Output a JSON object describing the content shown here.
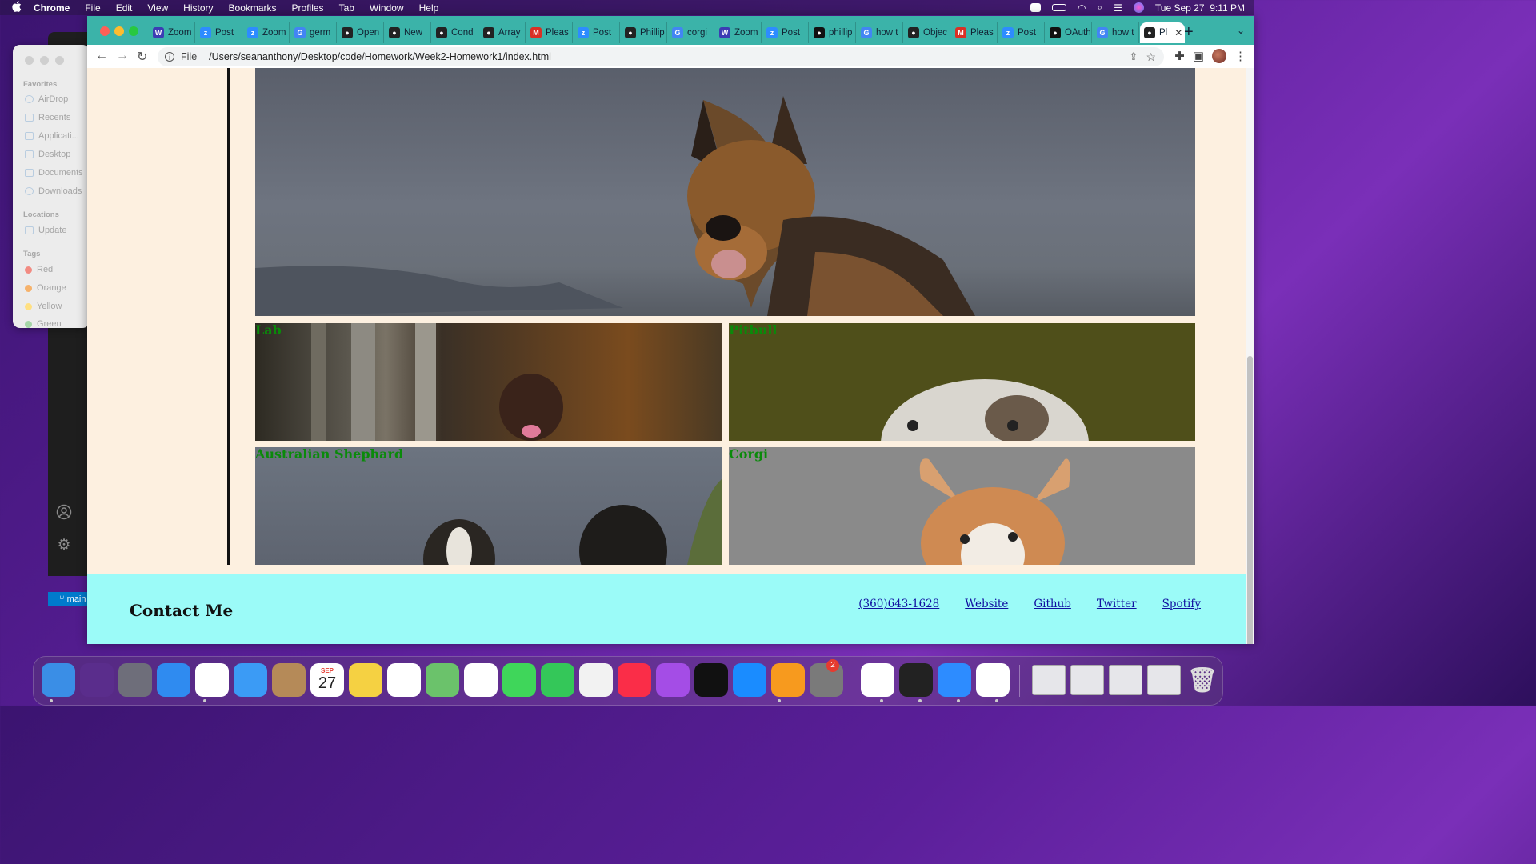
{
  "menubar": {
    "app": "Chrome",
    "items": [
      "File",
      "Edit",
      "View",
      "History",
      "Bookmarks",
      "Profiles",
      "Tab",
      "Window",
      "Help"
    ],
    "clock": "Tue Sep 27  9:11 PM"
  },
  "finder": {
    "favorites_label": "Favorites",
    "favorites": [
      "AirDrop",
      "Recents",
      "Applicati...",
      "Desktop",
      "Documents",
      "Downloads"
    ],
    "locations_label": "Locations",
    "locations": [
      "Update"
    ],
    "tags_label": "Tags",
    "tags": [
      {
        "name": "Red",
        "color": "#f28b82"
      },
      {
        "name": "Orange",
        "color": "#f6b26b"
      },
      {
        "name": "Yellow",
        "color": "#ffe082"
      },
      {
        "name": "Green",
        "color": "#a5d6a7"
      }
    ]
  },
  "vscode": {
    "branch": "main"
  },
  "chrome": {
    "tabs": [
      {
        "title": "Zoom",
        "icon": "W",
        "color": "#3c3cb4"
      },
      {
        "title": "Post",
        "icon": "z",
        "color": "#2d8cff"
      },
      {
        "title": "Zoom",
        "icon": "z",
        "color": "#2d8cff"
      },
      {
        "title": "germ",
        "icon": "G",
        "color": "#4285f4"
      },
      {
        "title": "Open",
        "icon": "●",
        "color": "#222222"
      },
      {
        "title": "New",
        "icon": "●",
        "color": "#222222"
      },
      {
        "title": "Cond",
        "icon": "●",
        "color": "#222222"
      },
      {
        "title": "Array",
        "icon": "●",
        "color": "#222222"
      },
      {
        "title": "Pleas",
        "icon": "M",
        "color": "#d93025"
      },
      {
        "title": "Post",
        "icon": "z",
        "color": "#2d8cff"
      },
      {
        "title": "Phillip",
        "icon": "●",
        "color": "#222222"
      },
      {
        "title": "corgi",
        "icon": "G",
        "color": "#4285f4"
      },
      {
        "title": "Zoom",
        "icon": "W",
        "color": "#3c3cb4"
      },
      {
        "title": "Post",
        "icon": "z",
        "color": "#2d8cff"
      },
      {
        "title": "phillip",
        "icon": "●",
        "color": "#111111"
      },
      {
        "title": "how t",
        "icon": "G",
        "color": "#4285f4"
      },
      {
        "title": "Objec",
        "icon": "●",
        "color": "#222222"
      },
      {
        "title": "Pleas",
        "icon": "M",
        "color": "#d93025"
      },
      {
        "title": "Post",
        "icon": "z",
        "color": "#2d8cff"
      },
      {
        "title": "OAuth",
        "icon": "●",
        "color": "#111111"
      },
      {
        "title": "how t",
        "icon": "G",
        "color": "#4285f4"
      },
      {
        "title": "Pl",
        "icon": "●",
        "color": "#222222",
        "active": true
      }
    ],
    "address": {
      "scheme": "File",
      "url": "/Users/seananthony/Desktop/code/Homework/Week2-Homework1/index.html"
    }
  },
  "page": {
    "tiles": [
      {
        "label": "Lab"
      },
      {
        "label": "Pitbull"
      },
      {
        "label": "Australian Shephard"
      },
      {
        "label": "Corgi"
      }
    ],
    "footer": {
      "title": "Contact Me",
      "links": [
        "(360)643-1628",
        "Website",
        "Github",
        "Twitter",
        "Spotify"
      ]
    }
  },
  "dock": {
    "apps": [
      {
        "name": "Finder",
        "icon": "finder-icon",
        "color": "#3a8ee6"
      },
      {
        "name": "Siri",
        "icon": "siri-icon",
        "color": "#5a2d8c"
      },
      {
        "name": "Launchpad",
        "icon": "launchpad-icon",
        "color": "#6e6e7a"
      },
      {
        "name": "Safari",
        "icon": "safari-icon",
        "color": "#2f8bf0"
      },
      {
        "name": "Chrome",
        "icon": "chrome-icon",
        "color": "#ffffff"
      },
      {
        "name": "Mail",
        "icon": "mail-icon",
        "color": "#3b9bf5"
      },
      {
        "name": "Contacts",
        "icon": "contacts-icon",
        "color": "#b58a58"
      },
      {
        "name": "Calendar",
        "icon": "calendar-icon",
        "color": "#ffffff"
      },
      {
        "name": "Notes",
        "icon": "notes-icon",
        "color": "#f5d142"
      },
      {
        "name": "Reminders",
        "icon": "reminders-icon",
        "color": "#ffffff"
      },
      {
        "name": "Maps",
        "icon": "maps-icon",
        "color": "#6bc26b"
      },
      {
        "name": "Photos",
        "icon": "photos-icon",
        "color": "#ffffff"
      },
      {
        "name": "Messages",
        "icon": "messages-icon",
        "color": "#3fd65a"
      },
      {
        "name": "FaceTime",
        "icon": "facetime-icon",
        "color": "#34c759"
      },
      {
        "name": "News",
        "icon": "news-icon",
        "color": "#f2f2f2"
      },
      {
        "name": "Music",
        "icon": "music-icon",
        "color": "#fa2d48"
      },
      {
        "name": "Podcasts",
        "icon": "podcasts-icon",
        "color": "#a44de6"
      },
      {
        "name": "TV",
        "icon": "tv-icon",
        "color": "#111111"
      },
      {
        "name": "App Store",
        "icon": "app-store-icon",
        "color": "#1a8cff"
      },
      {
        "name": "Pages",
        "icon": "pages-icon",
        "color": "#f79a1e"
      },
      {
        "name": "System Preferences",
        "icon": "system-preferences-icon",
        "color": "#7a7a7a"
      },
      {
        "name": "Slack",
        "icon": "slack-icon",
        "color": "#ffffff"
      },
      {
        "name": "Terminal",
        "icon": "terminal-icon",
        "color": "#222222"
      },
      {
        "name": "Zoom",
        "icon": "zoom-icon",
        "color": "#2d8cff"
      },
      {
        "name": "VS Code",
        "icon": "vscode-icon",
        "color": "#ffffff"
      }
    ],
    "calendar_month": "SEP",
    "calendar_day": "27",
    "system_prefs_badge": "2"
  }
}
